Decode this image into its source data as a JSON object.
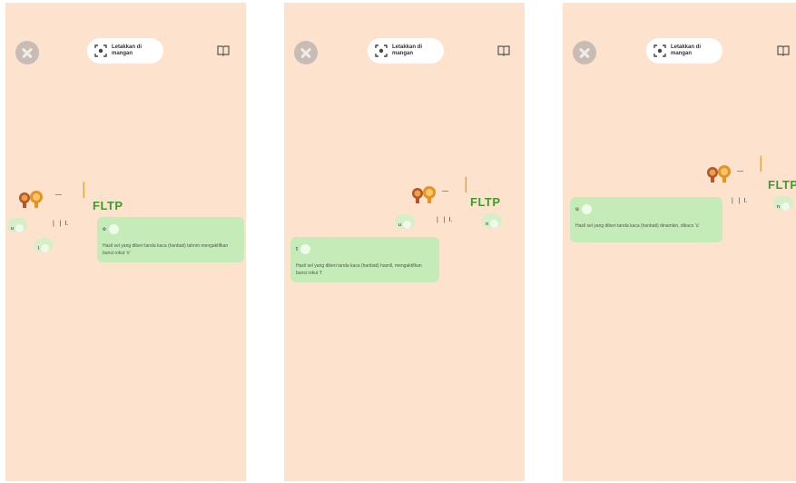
{
  "screens": [
    {
      "close_label": "",
      "scan_label_line1": "Letakkan di",
      "scan_label_line2": "mangan",
      "letters_big": "FLTP",
      "bubble_letter": "o",
      "bubble_text": "Hasil sel yang diberi tanda kaca (hanbati) tahnm mengaktifkan bunsi rokut 'o'",
      "mini_letters": [
        "u",
        "l",
        "..."
      ]
    },
    {
      "scan_label_line1": "Letakkan di",
      "scan_label_line2": "mangan",
      "letters_big": "FLTP",
      "bubble_letter": "t",
      "bubble_text": "Hasil sel yang diberi tanda kaca (hanbati) hasnll, mengaktifkan bunsi rokut 't'",
      "mini_letters": [
        "u",
        "n",
        "..."
      ]
    },
    {
      "scan_label_line1": "Letakkan di",
      "scan_label_line2": "mangan",
      "letters_big": "FLTP",
      "bubble_letter": "u",
      "bubble_text": "Hasil sel yang diberi tanda kaca (hanbati) dinamkin, dikaco 'u'",
      "mini_letters": [
        "n",
        "..."
      ]
    }
  ],
  "colors": {
    "screen_bg": "#fde3cd",
    "bubble_bg": "#c5ebb8",
    "accent_green": "#3d9d2b",
    "close_bg": "#c7bdb6"
  },
  "icons": [
    "close-icon",
    "scan-icon",
    "book-icon",
    "lion-icon"
  ]
}
